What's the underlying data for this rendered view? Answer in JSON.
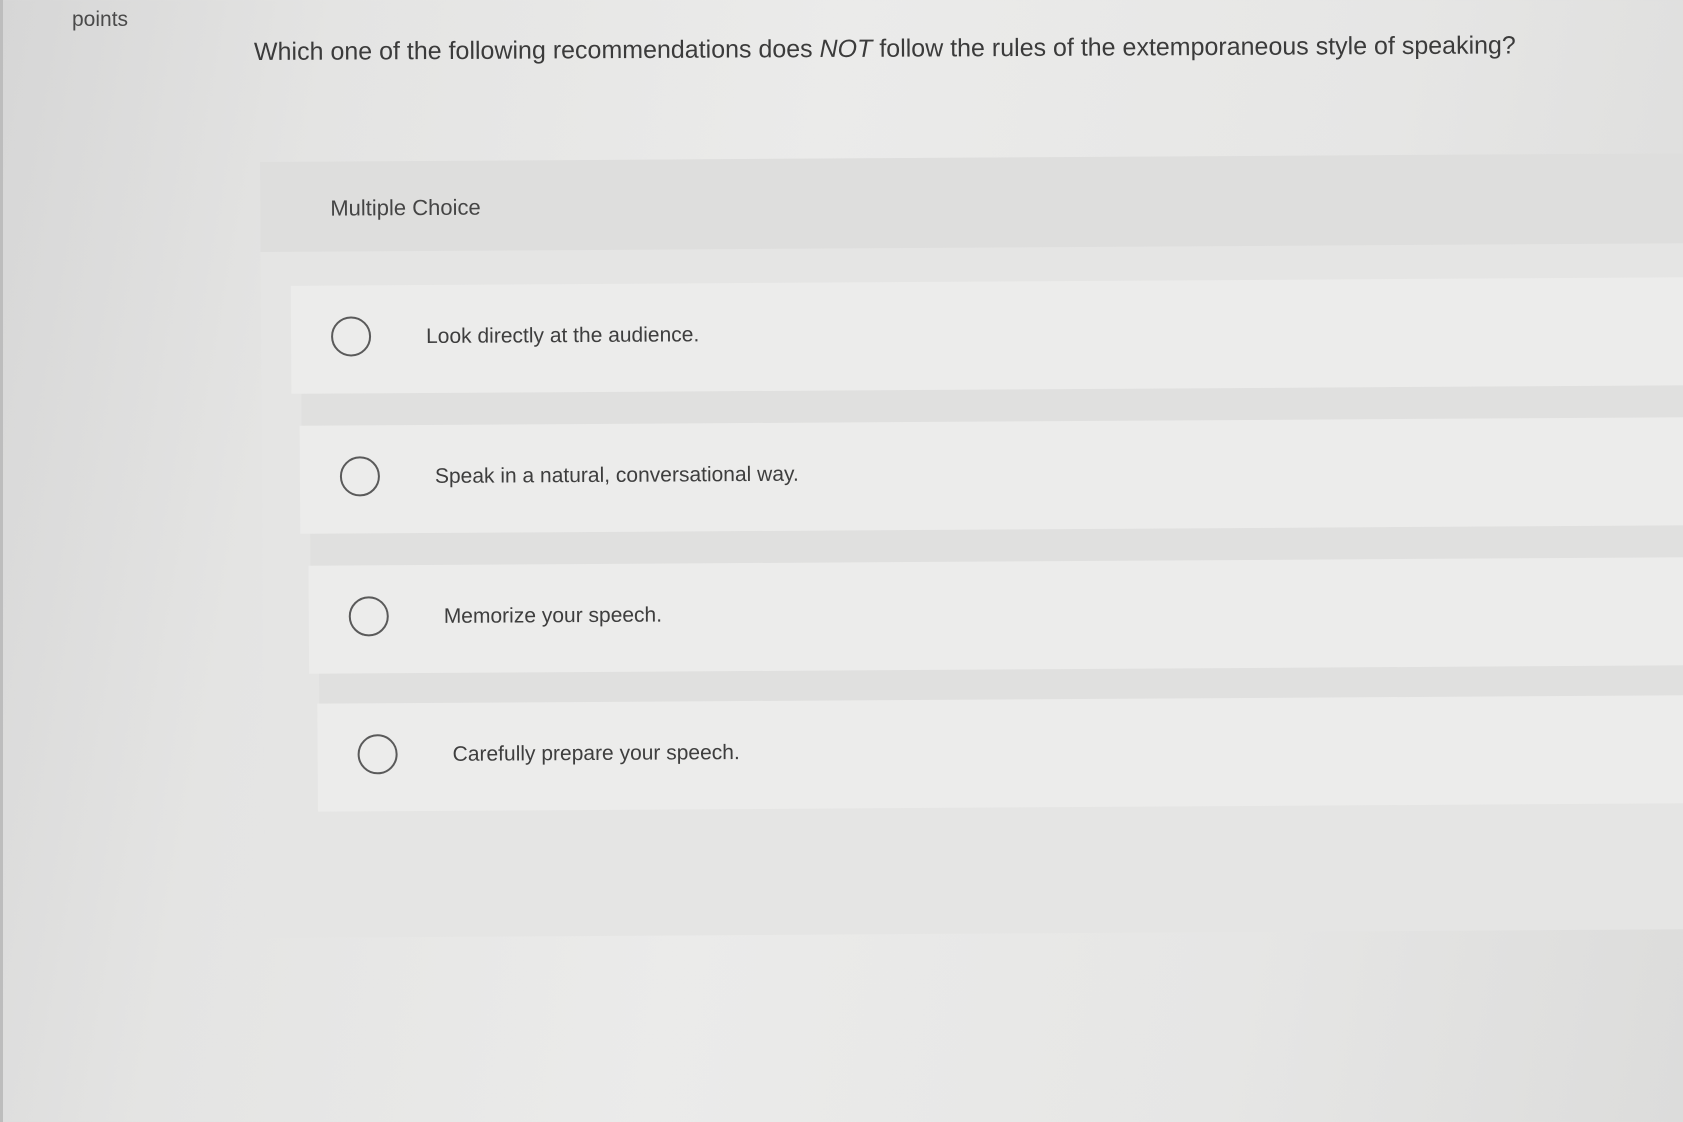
{
  "header": {
    "points_label": "points"
  },
  "question": {
    "prefix": "Which one of the following recommendations does ",
    "emphasis": "NOT",
    "suffix": " follow the rules of the extemporaneous style of speaking?"
  },
  "multiple_choice": {
    "title": "Multiple Choice",
    "options": [
      {
        "label": "Look directly at the audience.",
        "selected": false
      },
      {
        "label": "Speak in a natural, conversational way.",
        "selected": false
      },
      {
        "label": "Memorize your speech.",
        "selected": false
      },
      {
        "label": "Carefully prepare your speech.",
        "selected": false
      }
    ]
  }
}
